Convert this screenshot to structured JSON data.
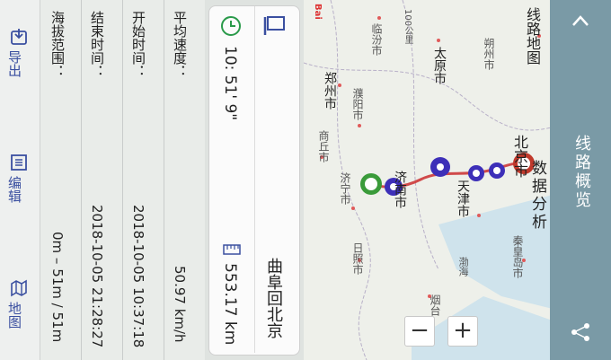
{
  "header": {
    "tabs": [
      {
        "label": "线路概览"
      },
      {
        "label": "数据分析"
      }
    ]
  },
  "map": {
    "logo_text": "Bai",
    "labels": {
      "route_map": "线路地图",
      "linfen": "临汾市",
      "taiyuan": "太原市",
      "shuozhou": "朔州市",
      "zhengzhou": "郑州市",
      "puyang": "濮阳市",
      "shangqiu": "商丘市",
      "jining": "济宁市",
      "jinan": "济南市",
      "tianjin": "天津市",
      "beijing": "北京市",
      "rizhao": "日照市",
      "qinhuangdao": "秦皇岛市",
      "bohai": "渤海",
      "yan": "烟台",
      "scale": "100公里"
    },
    "zoom_in": "+",
    "zoom_out": "−"
  },
  "card": {
    "route_name": "曲阜回北京",
    "duration": "10: 51' 9\"",
    "distance": "553.17 km",
    "pin_mark": "曲"
  },
  "details": {
    "rows": [
      {
        "label": "平均速度：",
        "value": "50.97 km/h"
      },
      {
        "label": "开始时间：",
        "value": "2018-10-05 10:37:18"
      },
      {
        "label": "结束时间：",
        "value": "2018-10-05 21:28:27"
      },
      {
        "label": "海拔范围：",
        "value": "0m – 51m / 51m"
      }
    ]
  },
  "toolbar": {
    "export_label": "导出",
    "edit_label": "编辑",
    "map_label": "地图"
  },
  "colors": {
    "accent": "#3a4fa0",
    "header_bg": "#7a9aa6",
    "start_marker": "#3a9b3a",
    "end_marker": "#c0392b",
    "route": "#d04a4a",
    "waypoint": "#3d2fb8"
  }
}
